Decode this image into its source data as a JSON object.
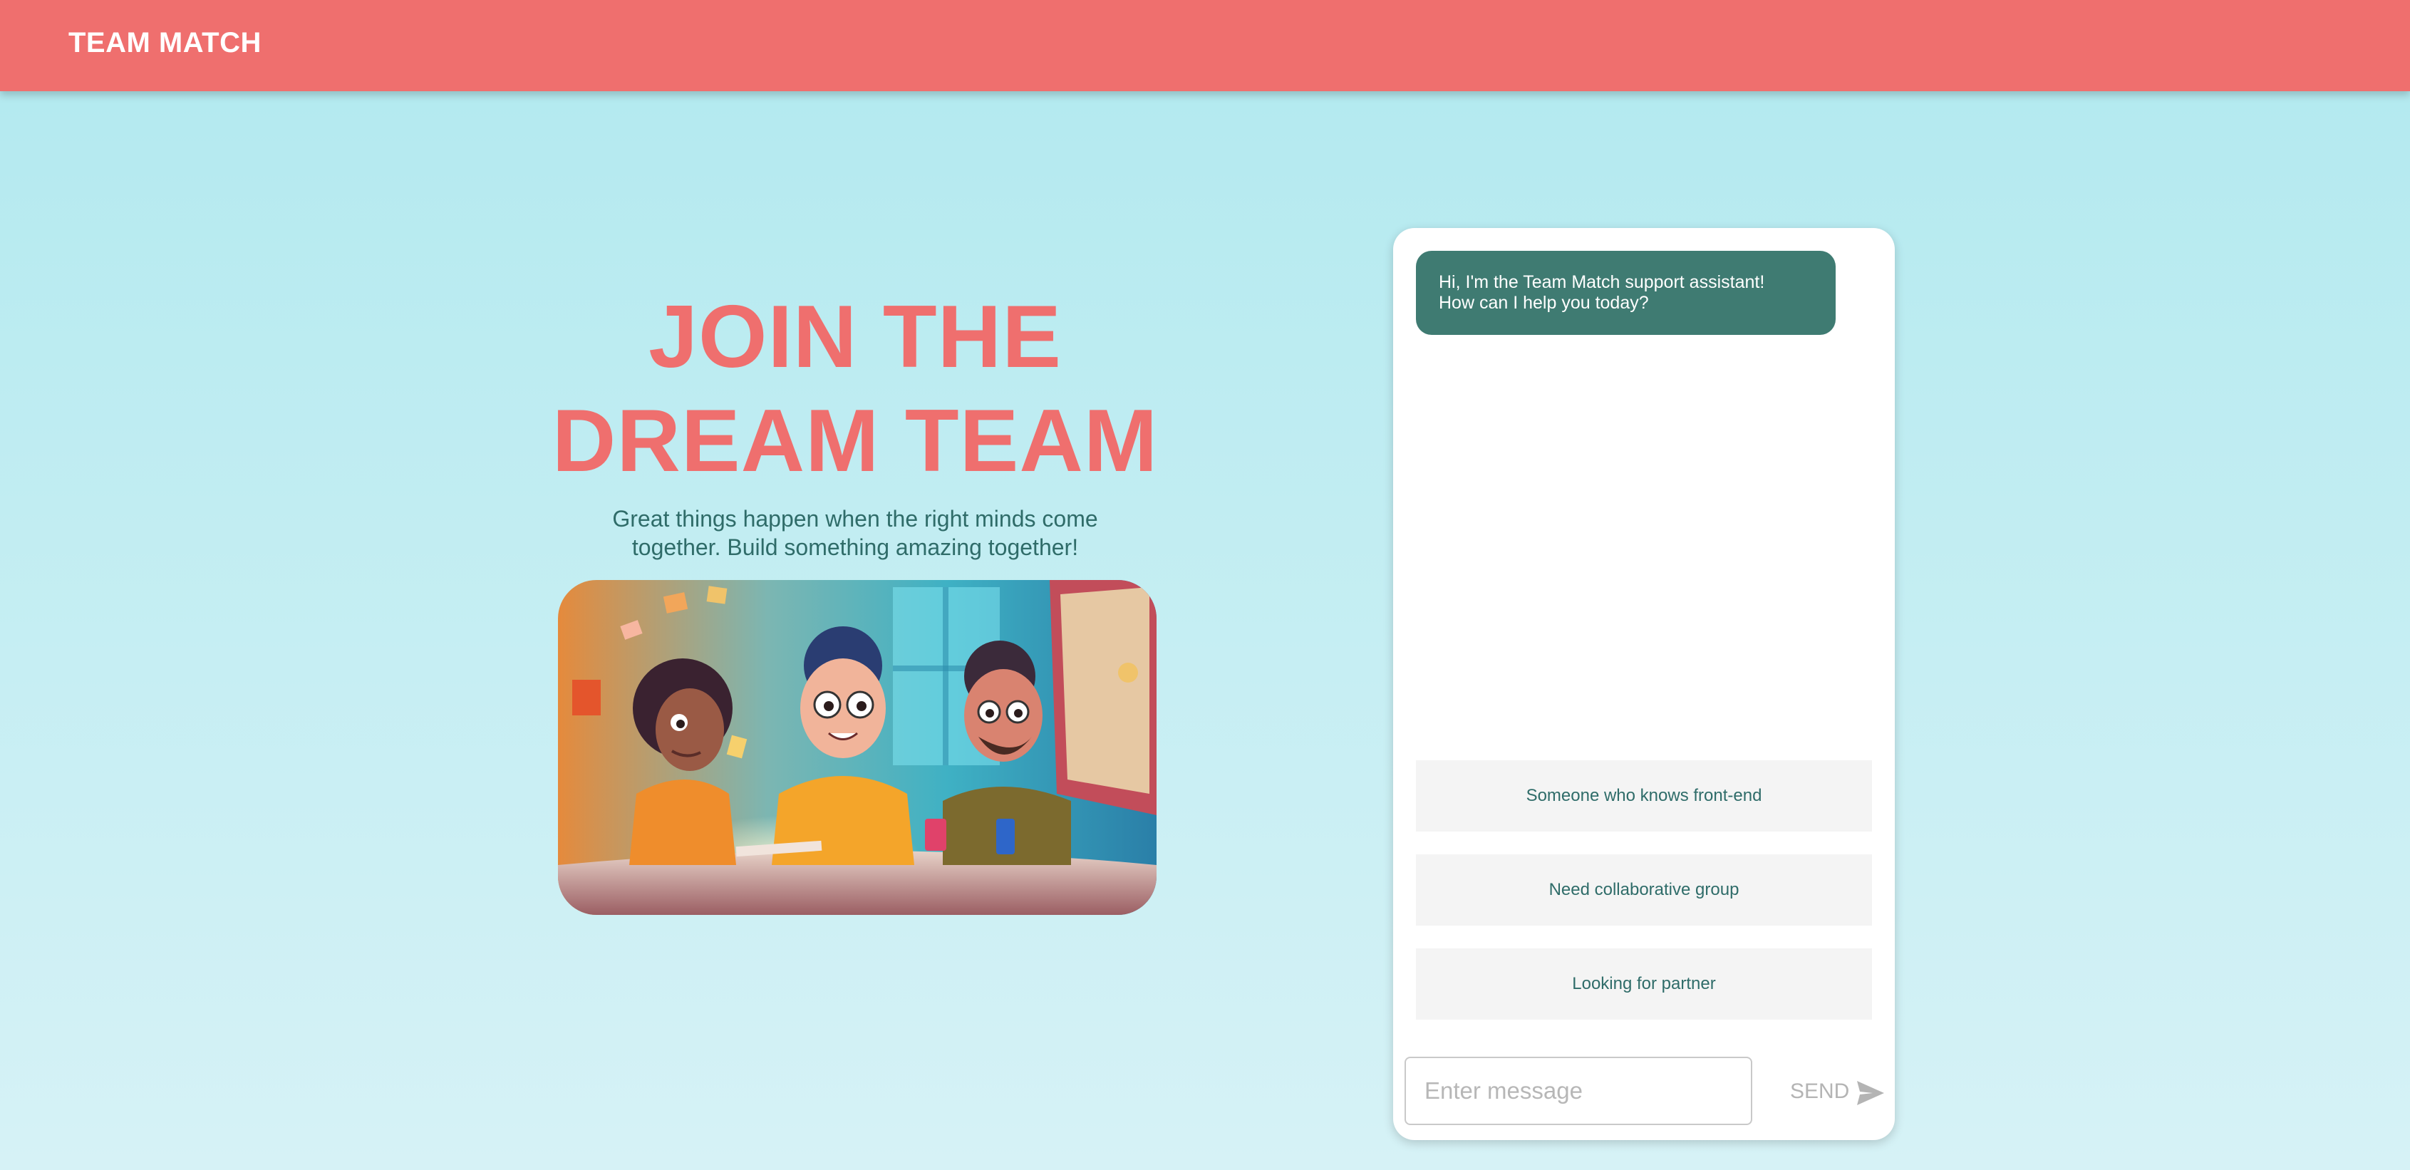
{
  "header": {
    "brand": "TEAM MATCH"
  },
  "hero": {
    "title_line1": "JOIN THE",
    "title_line2": "DREAM TEAM",
    "subtitle_line1": "Great things happen when the right minds come",
    "subtitle_line2": "together. Build something amazing together!",
    "image": "illustration of three smiling people collaborating at a desk with computers"
  },
  "chat": {
    "assistant_message_line1": "Hi, I'm the Team Match support assistant!",
    "assistant_message_line2": "How can I help you today?",
    "options": [
      "Someone who knows front-end",
      "Need collaborative group",
      "Looking for partner"
    ],
    "input_placeholder": "Enter message",
    "send_label": "SEND",
    "send_icon": "send-icon"
  },
  "colors": {
    "accent": "#ef6f6e",
    "bubble": "#3f7b72",
    "text_teal": "#2f6c69",
    "background_top": "#b1e9ef",
    "background_bottom": "#d6f2f6"
  }
}
